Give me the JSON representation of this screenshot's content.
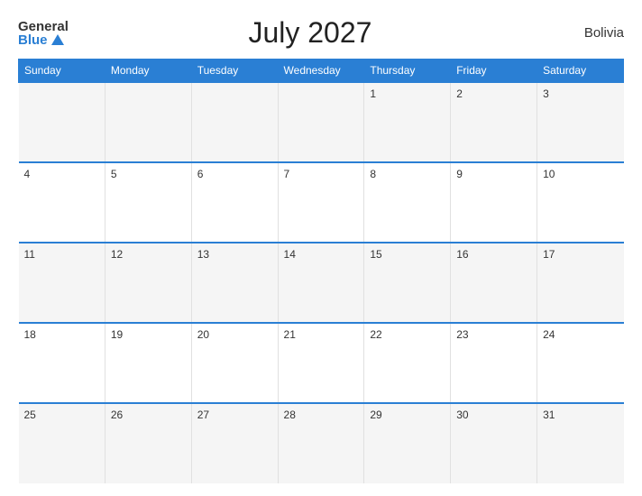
{
  "header": {
    "logo_general": "General",
    "logo_blue": "Blue",
    "title": "July 2027",
    "country": "Bolivia"
  },
  "days_of_week": [
    "Sunday",
    "Monday",
    "Tuesday",
    "Wednesday",
    "Thursday",
    "Friday",
    "Saturday"
  ],
  "weeks": [
    [
      null,
      null,
      null,
      null,
      1,
      2,
      3
    ],
    [
      4,
      5,
      6,
      7,
      8,
      9,
      10
    ],
    [
      11,
      12,
      13,
      14,
      15,
      16,
      17
    ],
    [
      18,
      19,
      20,
      21,
      22,
      23,
      24
    ],
    [
      25,
      26,
      27,
      28,
      29,
      30,
      31
    ]
  ]
}
